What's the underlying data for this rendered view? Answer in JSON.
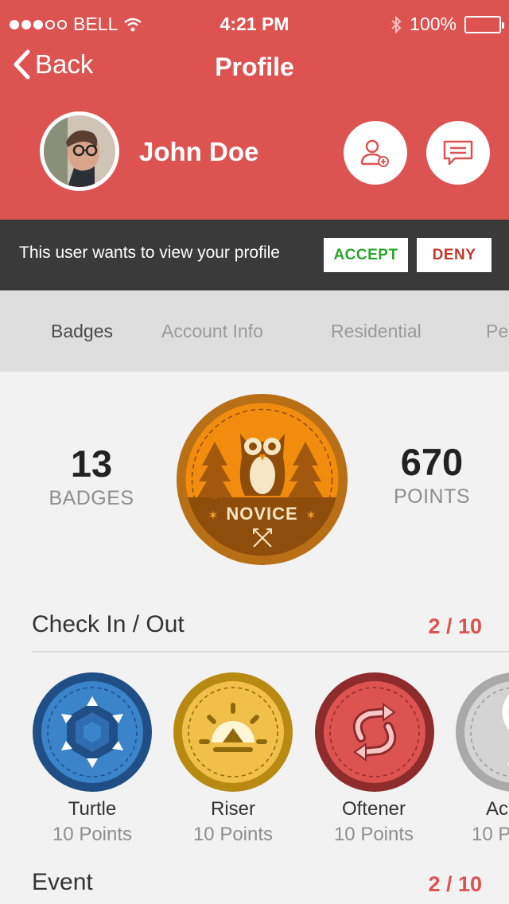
{
  "status_bar": {
    "carrier": "BELL",
    "time": "4:21 PM",
    "battery": "100%"
  },
  "nav": {
    "back_label": "Back",
    "title": "Profile"
  },
  "user": {
    "name": "John Doe"
  },
  "request": {
    "message": "This user wants to view your profile",
    "accept_label": "ACCEPT",
    "deny_label": "DENY"
  },
  "tabs": [
    {
      "label": "Badges"
    },
    {
      "label": "Account Info"
    },
    {
      "label": "Residential"
    },
    {
      "label": "Pe"
    }
  ],
  "stats": {
    "badges": {
      "value": "13",
      "label": "BADGES"
    },
    "points": {
      "value": "670",
      "label": "POINTS"
    },
    "level": "NOVICE"
  },
  "sections": [
    {
      "title": "Check In / Out",
      "count": "2 / 10",
      "badges": [
        {
          "name": "Turtle",
          "points": "10 Points",
          "color": "#3b84c9"
        },
        {
          "name": "Riser",
          "points": "10 Points",
          "color": "#f1c04a"
        },
        {
          "name": "Oftener",
          "points": "10 Points",
          "color": "#dc5351"
        },
        {
          "name": "Ac",
          "points": "10 P",
          "color": "#c8c8c8"
        }
      ]
    },
    {
      "title": "Event",
      "count": "2 / 10"
    }
  ],
  "colors": {
    "accent": "#dc5351",
    "dark_bar": "#3a3a3a",
    "accept": "#2aa52a",
    "deny": "#c0392b"
  }
}
